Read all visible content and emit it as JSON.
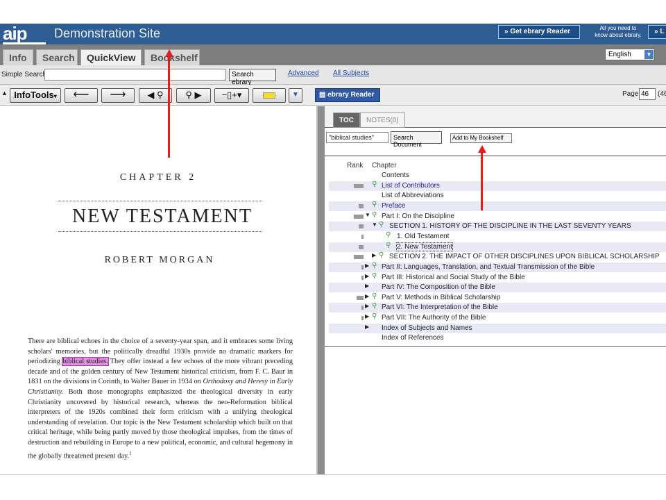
{
  "header": {
    "logo": "aip",
    "site_title": "Demonstration Site",
    "get_reader_label": "» Get ebrary Reader",
    "know_line1": "All you need to",
    "know_line2": "know about ebrary.",
    "second_btn_label": "» L"
  },
  "tabs": [
    {
      "label": "Info"
    },
    {
      "label": "Search"
    },
    {
      "label": "QuickView"
    },
    {
      "label": "Bookshelf"
    }
  ],
  "language": {
    "selected": "English"
  },
  "search": {
    "simple_label": "Simple Search:",
    "input_value": "",
    "button_label": "Search ebrary",
    "advanced_label": "Advanced",
    "subjects_label": "All Subjects"
  },
  "toolbar": {
    "infotools_label": "InfoTools",
    "ebrary_reader_label": "ebrary Reader",
    "page_label": "Page",
    "page_value": "46",
    "page_total": "(46"
  },
  "document": {
    "chapter_label": "CHAPTER 2",
    "chapter_title": "NEW TESTAMENT",
    "author": "ROBERT MORGAN",
    "body_before": "There are biblical echoes in the choice of a seventy-year span, and it embraces some living scholars' memories, but the politically dreadful 1930s provide no dramatic markers for periodizing ",
    "body_highlight": "biblical studies.",
    "body_mid": " They offer instead a few echoes of the more vibrant preceding decade and of the golden century of New Testament historical criticism, from F. C. Baur in 1831 on the divisions in Corinth, to Walter Bauer in 1934 on ",
    "body_italic": "Orthodoxy and Heresy in Early Christianity.",
    "body_after": " Both those monographs emphasized the theological diversity in early Christianity uncovered by historical research, whereas the neo-Reformation biblical interpreters of the 1920s combined their form criticism with a unifying theological understanding of revelation. Our topic is the New Testament scholarship which built on that critical heritage, while being partly moved by those theological impulses, from the times of destruction and rebuilding in Europe to a new political, economic, and cultural hegemony in the globally threatened present day.",
    "footnote_mark": "1"
  },
  "panel": {
    "tab_toc": "TOC",
    "tab_notes": "NOTES(0)",
    "doc_search_value": "\"biblical studies\"",
    "search_doc_label": "Search Document",
    "add_bookshelf_label": "Add to My Bookshelf",
    "rank_header": "Rank",
    "chapter_header": "Chapter"
  },
  "toc": [
    {
      "label": "Contents",
      "rank": 0,
      "shade": false,
      "tri": "",
      "mag": false,
      "indent": 0,
      "link": false
    },
    {
      "label": "List of Contributors",
      "rank": 0.85,
      "shade": true,
      "tri": "",
      "mag": true,
      "indent": 0,
      "link": true
    },
    {
      "label": "List of Abbreviations",
      "rank": 0,
      "shade": false,
      "tri": "",
      "mag": false,
      "indent": 0,
      "link": false
    },
    {
      "label": "Preface",
      "rank": 0.45,
      "shade": true,
      "tri": "",
      "mag": true,
      "indent": 0,
      "link": true
    },
    {
      "label": "Part I: On the Discipline",
      "rank": 0.85,
      "shade": false,
      "tri": "down",
      "mag": true,
      "indent": 0,
      "link": false
    },
    {
      "label": "SECTION 1. HISTORY OF THE DISCIPLINE IN THE LAST SEVENTY YEARS",
      "rank": 0.45,
      "shade": true,
      "tri": "down",
      "mag": true,
      "indent": 1,
      "link": false
    },
    {
      "label": "1. Old Testament",
      "rank": 0.2,
      "shade": false,
      "tri": "",
      "mag": true,
      "indent": 2,
      "link": false
    },
    {
      "label": "2. New Testament",
      "rank": 0.45,
      "shade": true,
      "tri": "",
      "mag": true,
      "indent": 2,
      "link": false,
      "boxed": true
    },
    {
      "label": "SECTION 2. THE IMPACT OF OTHER DISCIPLINES UPON BIBLICAL SCHOLARSHIP",
      "rank": 0.85,
      "shade": false,
      "tri": "right",
      "mag": true,
      "indent": 1,
      "link": false
    },
    {
      "label": "Part II: Languages, Translation, and Textual Transmission of the Bible",
      "rank": 0.2,
      "shade": true,
      "tri": "right",
      "mag": true,
      "indent": 0,
      "link": false
    },
    {
      "label": "Part III: Historical and Social Study of the Bible",
      "rank": 0.2,
      "shade": false,
      "tri": "right",
      "mag": true,
      "indent": 0,
      "link": false
    },
    {
      "label": "Part IV: The Composition of the Bible",
      "rank": 0,
      "shade": true,
      "tri": "right",
      "mag": false,
      "indent": 0,
      "link": false
    },
    {
      "label": "Part V: Methods in Biblical Scholarship",
      "rank": 0.6,
      "shade": false,
      "tri": "right",
      "mag": true,
      "indent": 0,
      "link": false
    },
    {
      "label": "Part VI: The Interpretation of the Bible",
      "rank": 0.2,
      "shade": true,
      "tri": "right",
      "mag": true,
      "indent": 0,
      "link": false
    },
    {
      "label": "Part VII: The Authority of the Bible",
      "rank": 0.2,
      "shade": false,
      "tri": "right",
      "mag": true,
      "indent": 0,
      "link": false
    },
    {
      "label": "Index of Subjects and Names",
      "rank": 0,
      "shade": true,
      "tri": "right",
      "mag": false,
      "indent": 0,
      "link": false
    },
    {
      "label": "Index of References",
      "rank": 0,
      "shade": false,
      "tri": "",
      "mag": false,
      "indent": 0,
      "link": false
    }
  ],
  "colors": {
    "header_bg": "#2e5d94",
    "annotation_arrow": "#e21e1e",
    "highlight": "#e08ee0"
  }
}
